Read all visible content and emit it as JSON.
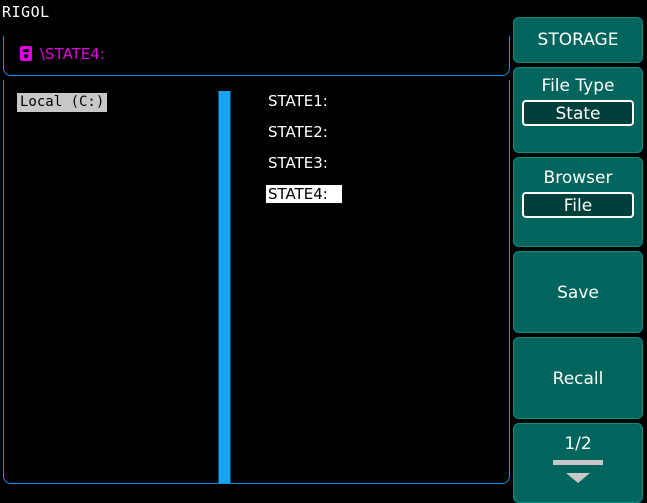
{
  "header": {
    "brand": "RIGOL"
  },
  "path": {
    "text": "\\STATE4:"
  },
  "browser": {
    "drive": "Local (C:)",
    "files": [
      {
        "name": "STATE1:",
        "selected": false
      },
      {
        "name": "STATE2:",
        "selected": false
      },
      {
        "name": "STATE3:",
        "selected": false
      },
      {
        "name": "STATE4:",
        "selected": true
      }
    ]
  },
  "menu": {
    "title": "STORAGE",
    "file_type_label": "File Type",
    "file_type_value": "State",
    "browser_label": "Browser",
    "browser_value": "File",
    "save_label": "Save",
    "recall_label": "Recall",
    "page_label": "1/2"
  },
  "colors": {
    "accent": "#1aa3f2",
    "softkey": "#00655c",
    "path": "#e000e0"
  }
}
